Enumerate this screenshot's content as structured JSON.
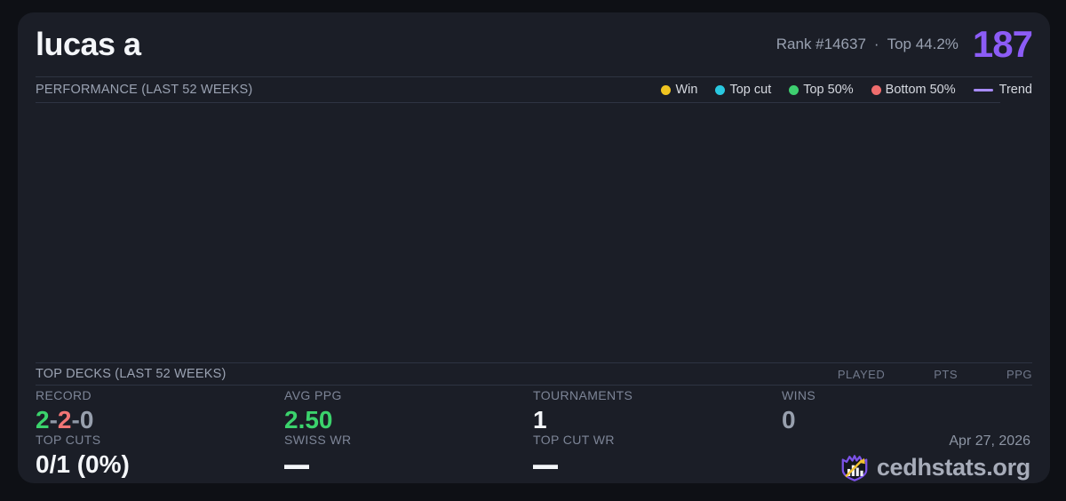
{
  "header": {
    "player_name": "lucas a",
    "rank": "Rank #14637",
    "separator": "·",
    "top_percent": "Top 44.2%",
    "points": "187"
  },
  "performance": {
    "title": "PERFORMANCE (LAST 52 WEEKS)",
    "legend": {
      "items": [
        {
          "label": "Win",
          "color": "#f0c420"
        },
        {
          "label": "Top cut",
          "color": "#29c8e0"
        },
        {
          "label": "Top 50%",
          "color": "#3ecf70"
        },
        {
          "label": "Bottom 50%",
          "color": "#ef6d6d"
        }
      ],
      "trend": {
        "label": "Trend",
        "color": "#a78bfa"
      }
    },
    "chart_points": []
  },
  "top_decks": {
    "title": "TOP DECKS (LAST 52 WEEKS)",
    "columns": [
      "PLAYED",
      "PTS",
      "PPG"
    ],
    "rows": []
  },
  "stats": {
    "record": {
      "label": "RECORD",
      "wins": "2",
      "losses": "2",
      "draws": "0",
      "sep": "-"
    },
    "avg_ppg": {
      "label": "AVG PPG",
      "value": "2.50"
    },
    "tournaments": {
      "label": "TOURNAMENTS",
      "value": "1"
    },
    "wins": {
      "label": "WINS",
      "value": "0"
    },
    "top_cuts": {
      "label": "TOP CUTS",
      "value": "0/1 (0%)"
    },
    "swiss_wr": {
      "label": "SWISS WR",
      "value": "—"
    },
    "top_cut_wr": {
      "label": "TOP CUT WR",
      "value": "—"
    }
  },
  "footer": {
    "date": "Apr 27, 2026",
    "brand": "cedhstats.org",
    "logo_icon": "shield-bar-chart-arrow"
  },
  "colors": {
    "page_background": "#0e1015",
    "card_background": "#1b1e27",
    "divider": "#2e3442",
    "accent_purple": "#8c5cf6",
    "trend_purple": "#a78bfa",
    "win_yellow": "#f0c420",
    "top_cut_cyan": "#29c8e0",
    "green": "#3bd36c",
    "red": "#f17575",
    "muted_gray": "#98a0ae"
  }
}
